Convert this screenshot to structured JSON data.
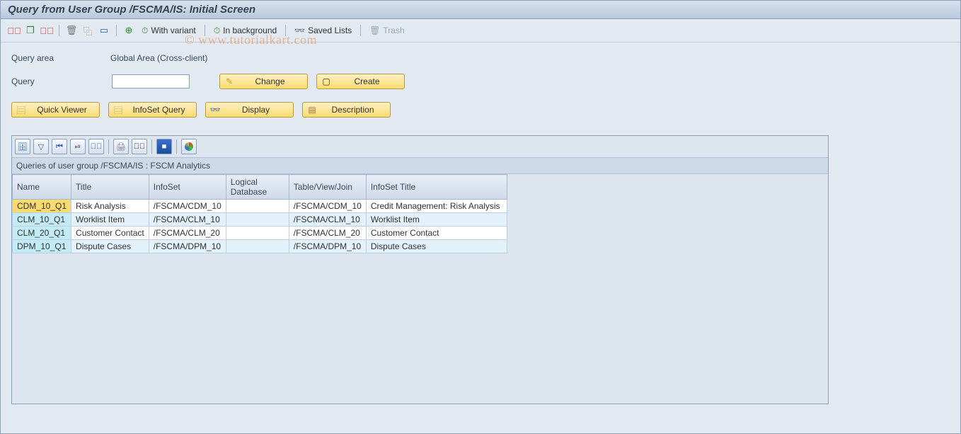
{
  "title": "Query from User Group /FSCMA/IS: Initial Screen",
  "watermark": "© www.tutorialkart.com",
  "app_toolbar": {
    "with_variant": "With variant",
    "in_background": "In background",
    "saved_lists": "Saved Lists",
    "trash": "Trash"
  },
  "form": {
    "query_area_label": "Query area",
    "query_area_value": "Global Area (Cross-client)",
    "query_label": "Query",
    "query_value": ""
  },
  "buttons": {
    "change": "Change",
    "create": "Create",
    "quick_viewer": "Quick Viewer",
    "infoset_query": "InfoSet Query",
    "display": "Display",
    "description": "Description"
  },
  "grid": {
    "caption": "Queries of user group /FSCMA/IS : FSCM Analytics",
    "columns": [
      "Name",
      "Title",
      "InfoSet",
      "Logical Database",
      "Table/View/Join",
      "InfoSet Title"
    ],
    "rows": [
      {
        "name": "CDM_10_Q1",
        "title": "Risk Analysis",
        "infoset": "/FSCMA/CDM_10",
        "ldb": "",
        "tvj": "/FSCMA/CDM_10",
        "it": "Credit  Management: Risk Analysis",
        "sel": true
      },
      {
        "name": "CLM_10_Q1",
        "title": "Worklist Item",
        "infoset": "/FSCMA/CLM_10",
        "ldb": "",
        "tvj": "/FSCMA/CLM_10",
        "it": "Worklist Item",
        "sel": false
      },
      {
        "name": "CLM_20_Q1",
        "title": "Customer Contact",
        "infoset": "/FSCMA/CLM_20",
        "ldb": "",
        "tvj": "/FSCMA/CLM_20",
        "it": "Customer Contact",
        "sel": false
      },
      {
        "name": "DPM_10_Q1",
        "title": "Dispute Cases",
        "infoset": "/FSCMA/DPM_10",
        "ldb": "",
        "tvj": "/FSCMA/DPM_10",
        "it": "Dispute Cases",
        "sel": false
      }
    ]
  }
}
